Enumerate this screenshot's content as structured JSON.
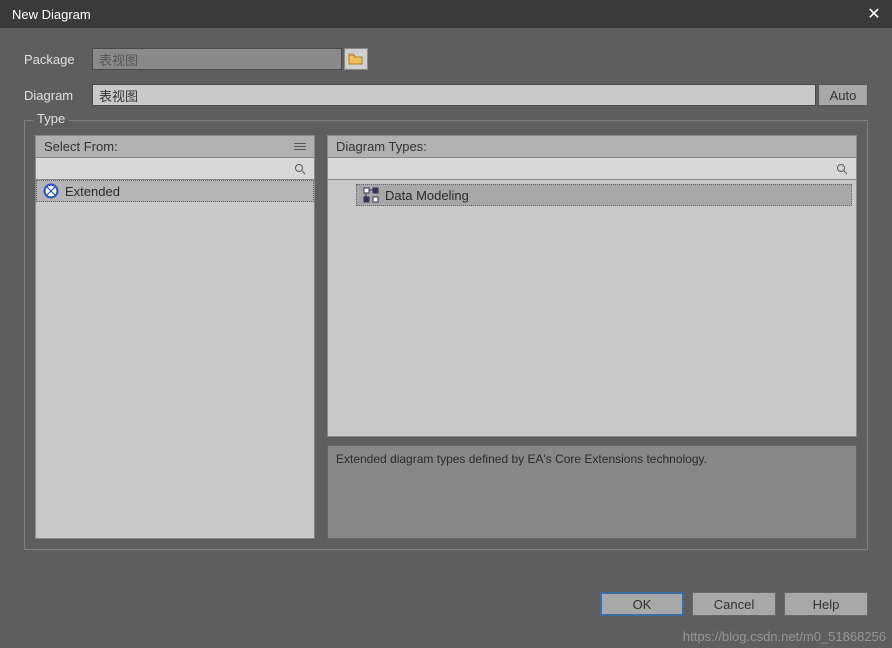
{
  "title": "New Diagram",
  "labels": {
    "package": "Package",
    "diagram": "Diagram",
    "auto": "Auto",
    "type": "Type",
    "selectFrom": "Select From:",
    "diagramTypes": "Diagram Types:"
  },
  "inputs": {
    "packageValue": "表视图",
    "diagramValue": "表视图"
  },
  "selectFrom": {
    "items": [
      {
        "label": "Extended",
        "icon": "extended-icon",
        "selected": true
      }
    ]
  },
  "diagramTypes": {
    "items": [
      {
        "label": "Data Modeling",
        "icon": "data-modeling-icon",
        "selected": true
      }
    ]
  },
  "description": "Extended diagram types defined by EA's Core Extensions technology.",
  "buttons": {
    "ok": "OK",
    "cancel": "Cancel",
    "help": "Help"
  },
  "watermark": "https://blog.csdn.net/m0_51868256"
}
